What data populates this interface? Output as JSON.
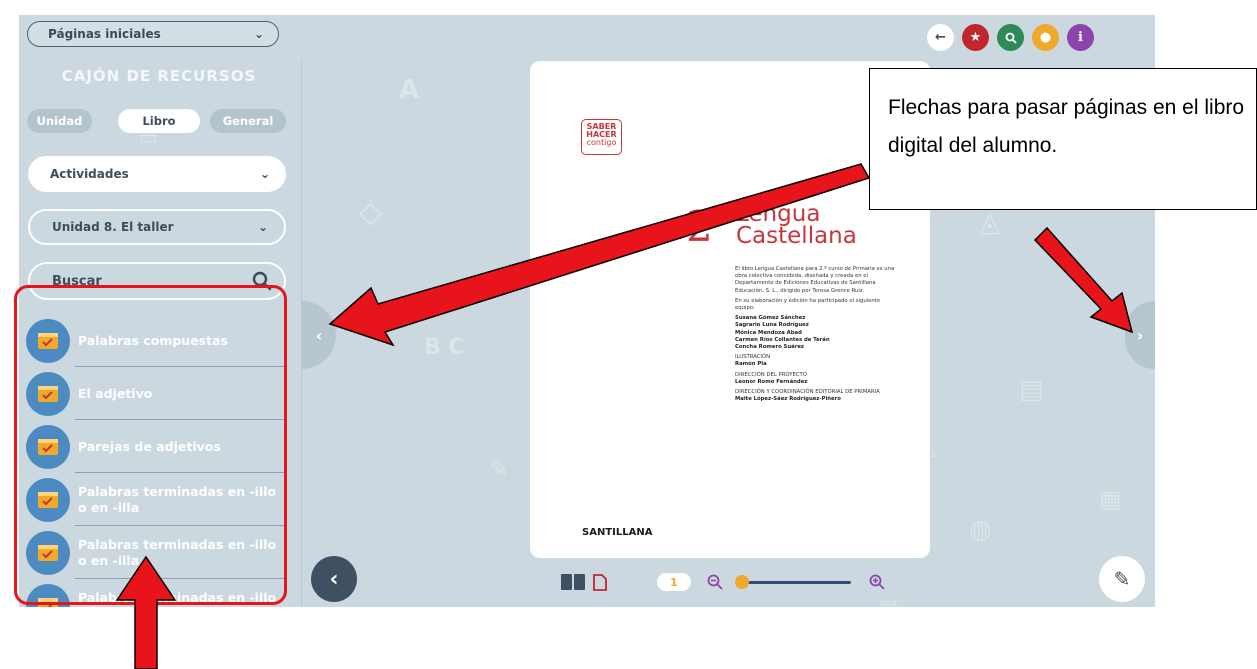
{
  "header": {
    "pages_select": "Páginas iniciales",
    "buttons": [
      {
        "icon": "arrow-left-icon",
        "glyph": "🡐",
        "color": "#ffffff"
      },
      {
        "icon": "star-icon",
        "glyph": "★",
        "color": "#c0272d"
      },
      {
        "icon": "search-icon",
        "glyph": "⚲",
        "color": "#2e8b57"
      },
      {
        "icon": "lightbulb-icon",
        "glyph": "♦",
        "color": "#f0a92b"
      },
      {
        "icon": "info-icon",
        "glyph": "i",
        "color": "#8e44ad"
      }
    ]
  },
  "sidebar": {
    "title": "CAJÓN DE RECURSOS",
    "tabs": [
      {
        "label": "Unidad",
        "active": false
      },
      {
        "label": "Libro",
        "active": true
      },
      {
        "label": "General",
        "active": false
      }
    ],
    "type_filter": "Actividades",
    "unit_filter": "Unidad 8. El taller",
    "search_placeholder": "Buscar",
    "items": [
      {
        "label": "Palabras compuestas"
      },
      {
        "label": "El adjetivo"
      },
      {
        "label": "Parejas de adjetivos"
      },
      {
        "label": "Palabras terminadas en -illo o en -illa"
      },
      {
        "label": "Palabras terminadas en -illo o en -illa"
      },
      {
        "label": "Palabras terminadas en -illo o en -illa"
      }
    ]
  },
  "book_page": {
    "logo": [
      "SABER",
      "HACER",
      "contigo"
    ],
    "grade": "2",
    "title_line1": "Lengua",
    "title_line2": "Castellana",
    "credits_intro": "El libro Lengua Castellana para 2.º curso de Primaria es una obra colectiva concebida, diseñada y creada en el Departamento de Ediciones Educativas de Santillana Educación, S. L., dirigido por Teresa Grence Ruiz.",
    "credits_team_intro": "En su elaboración y edición ha participado el siguiente equipo:",
    "team": [
      "Susana Gómez Sánchez",
      "Sagrario Luna Rodríguez",
      "Mónica Mendoza Abad",
      "Carmen Ríos Collantes de Terán",
      "Concha Romero Suárez"
    ],
    "illustration_label": "ILUSTRACIÓN",
    "illustration": "Ramón Pla",
    "direction_label": "DIRECCIÓN DEL PROYECTO",
    "direction": "Leonor Romo Fernández",
    "editorial_label": "DIRECCIÓN Y COORDINACIÓN EDITORIAL DE PRIMARIA",
    "editorial": "Maite López-Sáez Rodríguez-Piñero",
    "publisher": "SANTILLANA"
  },
  "viewer": {
    "page_number": "1",
    "zoom_level": 0.0
  },
  "annotation": {
    "callout_text": "Flechas para pasar páginas en el libro digital del alumno."
  }
}
